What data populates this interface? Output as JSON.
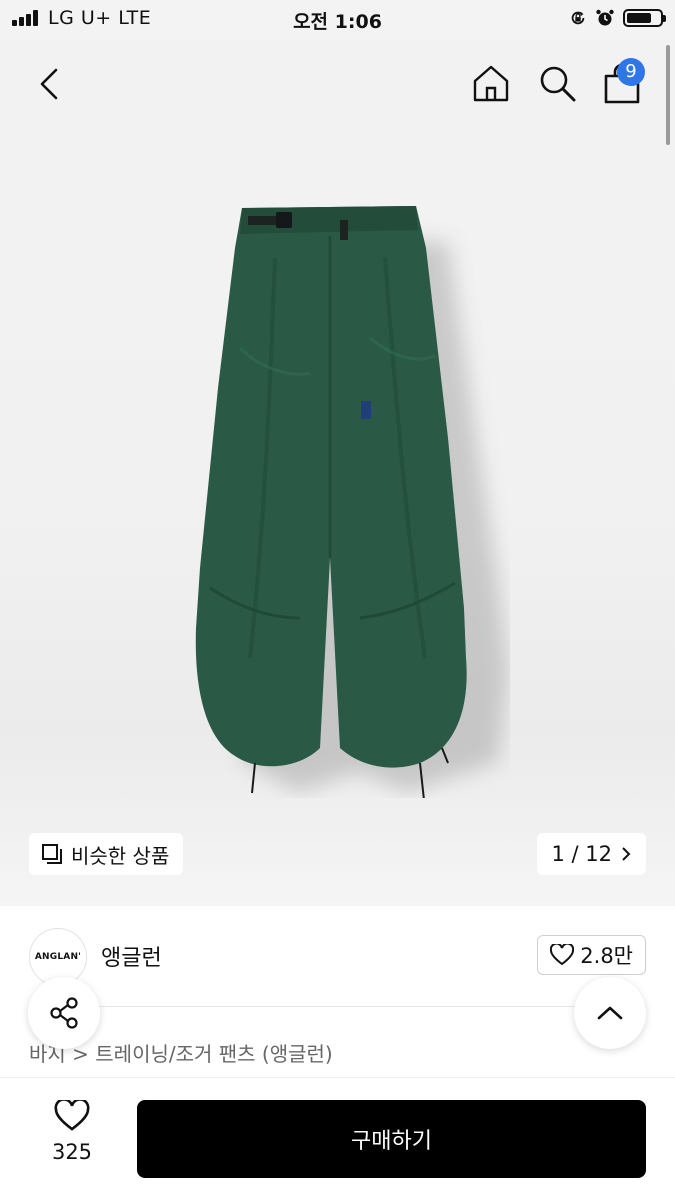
{
  "status_bar": {
    "carrier": "LG U+  LTE",
    "time": "오전 1:06"
  },
  "header": {
    "cart_badge": "9"
  },
  "hero": {
    "similar_label": "비슷한 상품",
    "counter": "1 / 12",
    "image_alt": "green nylon balloon pants"
  },
  "brand": {
    "logo_text": "ANGLAN'",
    "name": "앵글런",
    "likes": "2.8만"
  },
  "breadcrumb": "바지 > 트레이닝/조거 팬츠 (앵글런)",
  "bottom": {
    "wish_count": "325",
    "buy_label": "구매하기"
  },
  "colors": {
    "badge": "#2f77e8",
    "pants": "#2a5a46",
    "buy_button": "#000000"
  }
}
